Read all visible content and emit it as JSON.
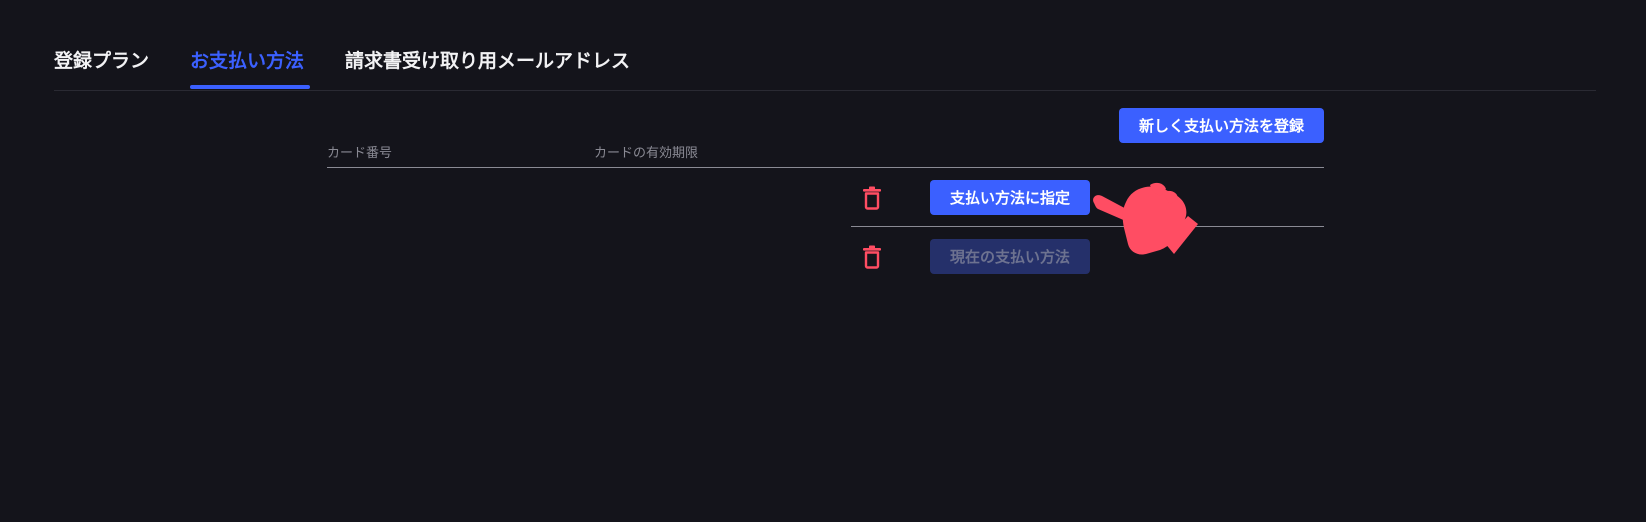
{
  "tabs": [
    {
      "label": "登録プラン",
      "active": false
    },
    {
      "label": "お支払い方法",
      "active": true
    },
    {
      "label": "請求書受け取り用メールアドレス",
      "active": false
    }
  ],
  "actions": {
    "register_label": "新しく支払い方法を登録"
  },
  "table": {
    "columns": [
      "カード番号",
      "カードの有効期限"
    ],
    "rows": [
      {
        "card_number": "",
        "expiry": "",
        "action_label": "支払い方法に指定",
        "is_current": false
      },
      {
        "card_number": "",
        "expiry": "",
        "action_label": "現在の支払い方法",
        "is_current": true
      }
    ]
  },
  "icons": {
    "delete": "trash-icon",
    "pointer": "pointing-hand-icon"
  },
  "colors": {
    "background": "#14141b",
    "accent": "#3b60ff",
    "accent_disabled": "#25306a",
    "danger": "#ff4d63",
    "text": "#f2f2f4",
    "muted": "#8a8a94"
  }
}
